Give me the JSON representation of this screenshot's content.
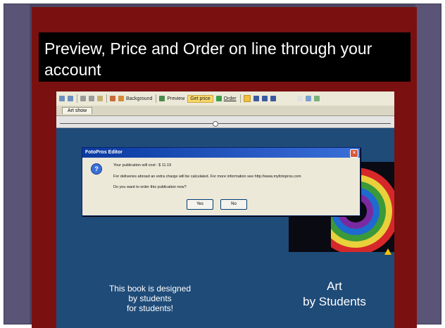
{
  "slide": {
    "title": "Preview, Price and Order on line through your account"
  },
  "toolbar": {
    "background_label": "Background",
    "preview_label": "Preview",
    "getprice_label": "Get price",
    "order_label": "Order"
  },
  "tab": {
    "label": "Art show"
  },
  "dialog": {
    "title": "FotoPros Editor",
    "line1": "Your publication will cost : $ 11.19",
    "line2": "For deliveries abroad an extra charge will be calculated. For more information see http://www.myfotopros.com",
    "line3": "Do you want to order this publication now?",
    "yes_label": "Yes",
    "no_label": "No",
    "question_glyph": "?"
  },
  "page": {
    "left_text_1": "This book is designed",
    "left_text_2": "by students",
    "left_text_3": "for students!",
    "right_text_1": "Art",
    "right_text_2": "by Students"
  },
  "colors": {
    "slide_bg": "#7a1010",
    "frame": "#4a4662",
    "page_blue": "#1f4b78"
  }
}
